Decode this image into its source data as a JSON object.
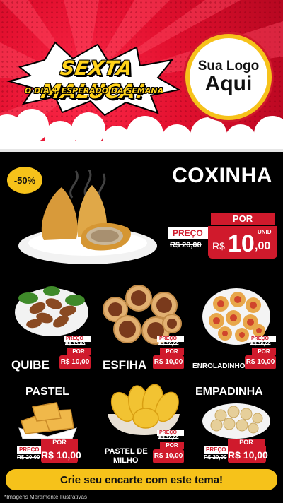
{
  "hero": {
    "title": "SEXTA MALUCA!",
    "subtitle": "O DIA + ESPERADO DA SEMANA",
    "logo_line1": "Sua Logo",
    "logo_line2": "Aqui"
  },
  "featured": {
    "badge": "-50%",
    "name": "COXINHA",
    "por_label": "POR",
    "preco_label": "PREÇO",
    "old_price": "R$ 20,00",
    "price_currency": "R$",
    "price_int": "10",
    "price_dec": ",00",
    "unid": "UNID"
  },
  "items": [
    {
      "name": "QUIBE",
      "old": "R$ 20,00",
      "price": "R$ 10,00"
    },
    {
      "name": "ESFIHA",
      "old": "R$ 20,00",
      "price": "R$ 10,00"
    },
    {
      "name": "ENROLADINHO",
      "old": "R$ 20,00",
      "price": "R$ 10,00"
    },
    {
      "name": "PASTEL",
      "old": "R$ 20,00",
      "price": "R$ 10,00"
    },
    {
      "name": "PASTEL DE",
      "name2": "MILHO",
      "old": "R$ 20,00",
      "price": "R$ 10,00"
    },
    {
      "name": "EMPADINHA",
      "old": "R$ 20,00",
      "price": "R$ 10,00"
    }
  ],
  "labels": {
    "por": "POR",
    "preco": "PREÇO",
    "unid": "UNID"
  },
  "cta": "Crie seu encarte com este tema!",
  "disclaimer": "*Imagens Meramente Ilustrativas",
  "colors": {
    "red": "#d01a2c",
    "yellow": "#f6c21a",
    "black": "#000000"
  }
}
